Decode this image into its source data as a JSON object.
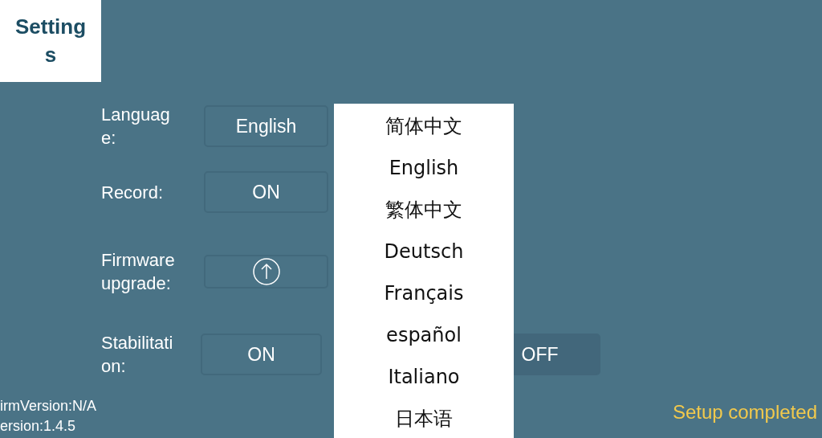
{
  "header": {
    "title": "Settings"
  },
  "settings": [
    {
      "kind": "text",
      "label": "Language:",
      "value": "English"
    },
    {
      "kind": "text",
      "label": "Record:",
      "value": "ON"
    },
    {
      "kind": "upload",
      "label": "Firmware upgrade:"
    },
    {
      "kind": "choice",
      "label": "Stabilitation:",
      "options": [
        {
          "label": "ON",
          "selected": false
        },
        {
          "label": "OFF",
          "selected": true
        }
      ]
    }
  ],
  "language_menu": [
    "简体中文",
    "English",
    "繁体中文",
    "Deutsch",
    "Français",
    "español",
    "Italiano",
    "日本语"
  ],
  "versions": [
    "irmVersion:N/A",
    "ersion:1.4.5"
  ],
  "status": "Setup completed"
}
